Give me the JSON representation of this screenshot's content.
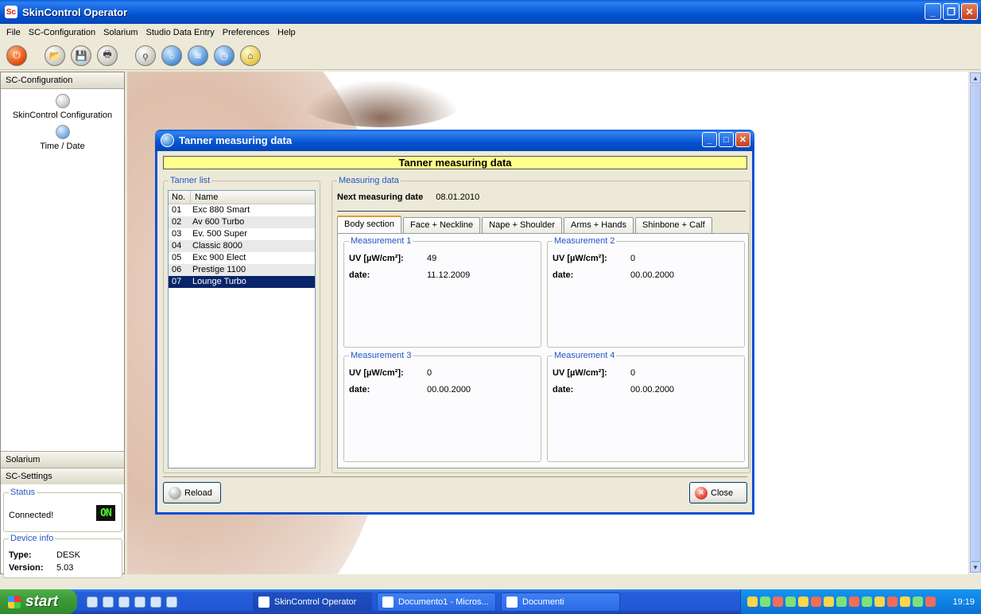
{
  "window": {
    "title": "SkinControl Operator",
    "app_icon_text": "Sc"
  },
  "menu": [
    "File",
    "SC-Configuration",
    "Solarium",
    "Studio Data Entry",
    "Preferences",
    "Help"
  ],
  "left_panel": {
    "header": "SC-Configuration",
    "items": [
      {
        "label": "SkinControl Configuration",
        "icon": "probe-icon"
      },
      {
        "label": "Time / Date",
        "icon": "clock-icon"
      }
    ],
    "sections": [
      "Solarium",
      "SC-Settings"
    ],
    "status": {
      "legend": "Status",
      "text": "Connected!",
      "led": "ON"
    },
    "device_info": {
      "legend": "Device info",
      "type_label": "Type:",
      "type_value": "DESK",
      "version_label": "Version:",
      "version_value": "5.03"
    }
  },
  "dialog": {
    "title": "Tanner measuring data",
    "banner": "Tanner measuring data",
    "tanner_list": {
      "legend": "Tanner list",
      "headers": [
        "No.",
        "Name"
      ],
      "rows": [
        {
          "no": "01",
          "name": "Exc 880 Smart"
        },
        {
          "no": "02",
          "name": "Av 600 Turbo"
        },
        {
          "no": "03",
          "name": "Ev. 500 Super"
        },
        {
          "no": "04",
          "name": "Classic 8000"
        },
        {
          "no": "05",
          "name": "Exc 900 Elect"
        },
        {
          "no": "06",
          "name": "Prestige 1100"
        },
        {
          "no": "07",
          "name": "Lounge Turbo"
        }
      ],
      "selected_index": 6
    },
    "measuring": {
      "legend": "Measuring data",
      "next_label": "Next measuring date",
      "next_value": "08.01.2010",
      "tabs": [
        "Body section",
        "Face + Neckline",
        "Nape + Shoulder",
        "Arms + Hands",
        "Shinbone + Calf"
      ],
      "active_tab": 0,
      "uv_label": "UV [µW/cm²]:",
      "date_label": "date:",
      "measurements": [
        {
          "legend": "Measurement 1",
          "uv": "49",
          "date": "11.12.2009"
        },
        {
          "legend": "Measurement 2",
          "uv": "0",
          "date": "00.00.2000"
        },
        {
          "legend": "Measurement 3",
          "uv": "0",
          "date": "00.00.2000"
        },
        {
          "legend": "Measurement 4",
          "uv": "0",
          "date": "00.00.2000"
        }
      ]
    },
    "buttons": {
      "reload": "Reload",
      "close": "Close"
    }
  },
  "taskbar": {
    "start": "start",
    "tasks": [
      "SkinControl Operator",
      "Documento1 - Micros...",
      "Documenti"
    ],
    "clock": "19:19"
  }
}
